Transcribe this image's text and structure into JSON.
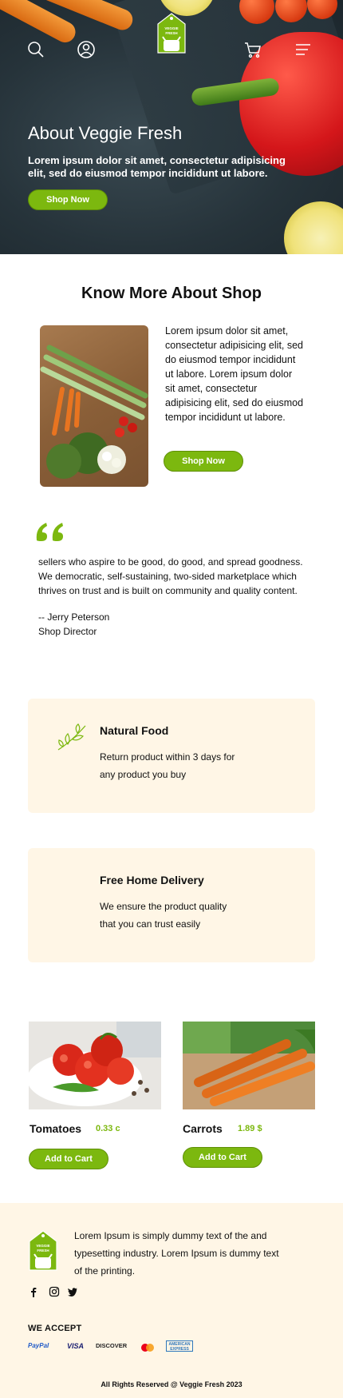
{
  "hero": {
    "logo_text_line1": "VEGGIE",
    "logo_text_line2": "FRESH",
    "title": "About Veggie Fresh",
    "text": "Lorem ipsum dolor sit amet, consectetur adipisicing elit, sed do eiusmod tempor incididunt ut labore.",
    "button": "Shop Now"
  },
  "about": {
    "title": "Know More About Shop",
    "text": "Lorem ipsum dolor sit amet, consectetur adipisicing elit, sed do eiusmod tempor incididunt ut labore. Lorem ipsum dolor sit amet, consectetur adipisicing elit, sed do eiusmod tempor incididunt ut labore.",
    "button": "Shop Now"
  },
  "testimonial": {
    "text": "sellers who aspire to be good, do good, and spread goodness. We democratic, self-sustaining, two-sided marketplace which thrives on trust and is built on community and quality content.",
    "author": "-- Jerry Peterson",
    "role": "Shop Director"
  },
  "features": [
    {
      "title": "Natural Food",
      "desc": "Return product within 3 days for any product you buy",
      "icon": "leaf-icon"
    },
    {
      "title": "Free Home Delivery",
      "desc": "We ensure the product quality that you can trust easily",
      "icon": ""
    }
  ],
  "products": [
    {
      "name": "Tomatoes",
      "price": "0.33 c",
      "button": "Add to Cart"
    },
    {
      "name": "Carrots",
      "price": "1.89 $",
      "button": "Add to Cart"
    }
  ],
  "footer": {
    "text": "Lorem Ipsum is simply dummy text of the and typesetting industry. Lorem Ipsum is dummy text of the printing.",
    "we_accept": "WE ACCEPT",
    "payments": [
      "PayPal",
      "VISA",
      "DISCOVER",
      "mastercard",
      "AMERICAN EXPRESS"
    ],
    "copyright": "All Rights Reserved @ Veggie Fresh 2023"
  },
  "colors": {
    "accent": "#7cb80f",
    "cream": "#fff6e6",
    "dark": "#26333a"
  }
}
